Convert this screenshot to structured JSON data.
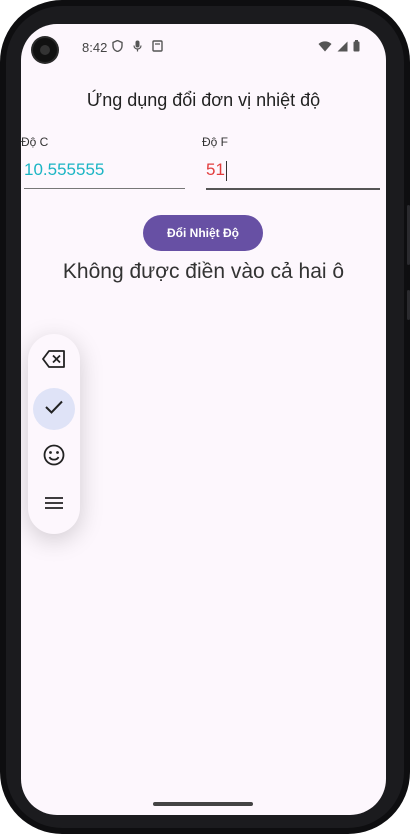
{
  "status_bar": {
    "time": "8:42",
    "left_icons": [
      "shield-icon",
      "microphone-icon",
      "clipboard-icon"
    ],
    "right_icons": [
      "wifi-icon",
      "signal-icon",
      "battery-icon"
    ]
  },
  "app": {
    "title": "Ứng dụng đổi đơn vị nhiệt độ",
    "celsius_label": "Độ C",
    "celsius_value": "10.555555",
    "fahrenheit_label": "Độ F",
    "fahrenheit_value": "51",
    "convert_button": "Đổi Nhiệt Độ",
    "message": "Không được điền vào cả hai ô"
  },
  "keyboard_toolbar": {
    "items": [
      "backspace-icon",
      "check-icon",
      "emoji-icon",
      "menu-icon"
    ],
    "active_index": 1
  },
  "colors": {
    "accent": "#6750a4",
    "celsius_text": "#1bb5c4",
    "fahrenheit_text": "#e23d3d",
    "background": "#fdf7fd"
  }
}
